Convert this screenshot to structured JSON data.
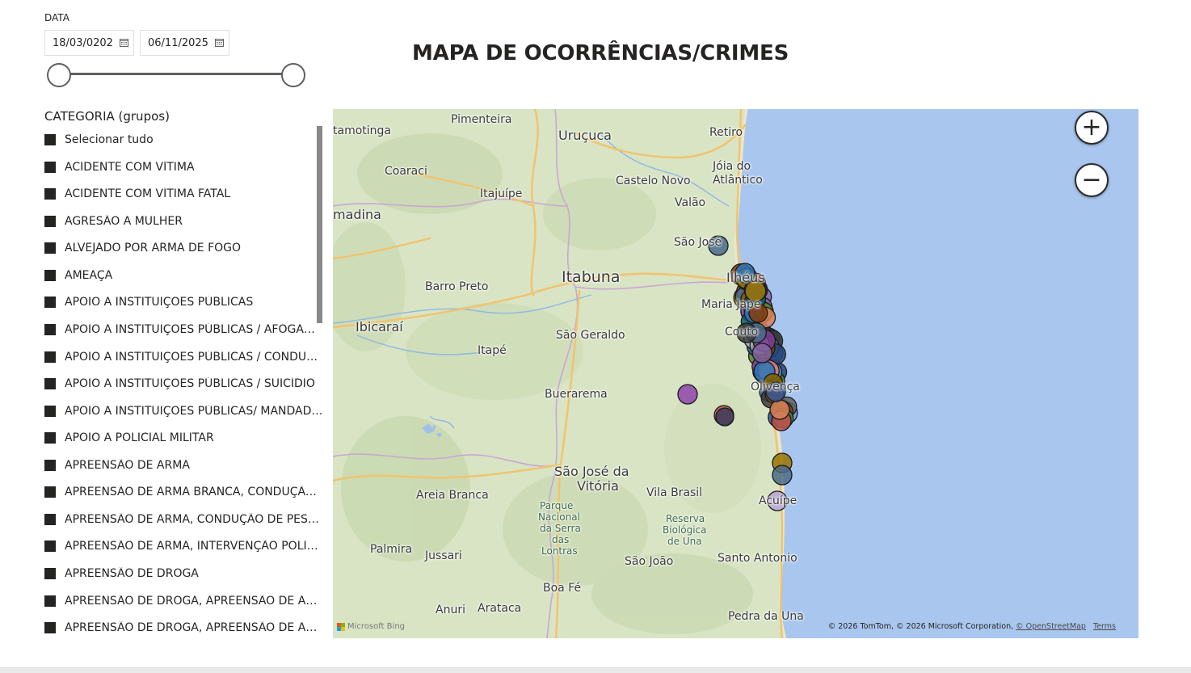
{
  "date_slicer": {
    "label": "DATA",
    "from": "18/03/0202",
    "to": "06/11/2025"
  },
  "title": "MAPA DE OCORRÊNCIAS/CRIMES",
  "category_slicer": {
    "header": "CATEGORIA (grupos)",
    "items": [
      "Selecionar tudo",
      "ACIDENTE COM VÍTIMA",
      "ACIDENTE COM VÍTIMA FATAL",
      "AGRESÃO A MULHER",
      "ALVEJADO POR ARMA DE FOGO",
      "AMEAÇA",
      "APOIO A INSTITUIÇÕES PÚBLICAS",
      "APOIO A INSTITUIÇÕES PÚBLICAS / AFOGAMENTO",
      "APOIO A INSTITUIÇÕES PÚBLICAS / CONDUÇÃO",
      "APOIO A INSTITUIÇÕES PÚBLICAS / SUICÍDIO",
      "APOIO A INSTITUIÇÕES PÚBLICAS/ MANDADO DE PRISÃO",
      "APOIO A POLICIAL MILITAR",
      "APREENSÃO DE ARMA",
      "APREENSÃO DE ARMA BRANCA, CONDUÇÃO DE PESSOA",
      "APREENSÃO DE ARMA, CONDUÇÃO DE PESSOA",
      "APREENSÃO DE ARMA, INTERVENÇÃO POLICIAL",
      "APREENSÃO DE DROGA",
      "APREENSÃO DE DROGA, APREENSÃO DE ARMA",
      "APREENSÃO DE DROGA, APREENSÃO DE ARMA, CONDUÇÃO"
    ]
  },
  "map": {
    "places": [
      {
        "name": "Pimenteira",
        "cls": ""
      },
      {
        "name": "Uruçuca",
        "cls": "med"
      },
      {
        "name": "Retiro",
        "cls": ""
      },
      {
        "name": "tamotinga",
        "cls": ""
      },
      {
        "name": "Coaraci",
        "cls": ""
      },
      {
        "name": "Castelo Novo",
        "cls": ""
      },
      {
        "name": "Jóia do",
        "cls": ""
      },
      {
        "name": "Atlântico",
        "cls": ""
      },
      {
        "name": "Itajuípe",
        "cls": ""
      },
      {
        "name": "Valão",
        "cls": ""
      },
      {
        "name": "madina",
        "cls": "med"
      },
      {
        "name": "São José",
        "cls": ""
      },
      {
        "name": "Itabuna",
        "cls": "big"
      },
      {
        "name": "Barro Preto",
        "cls": ""
      },
      {
        "name": "Ilhéus",
        "cls": "med"
      },
      {
        "name": "Maria Jape",
        "cls": ""
      },
      {
        "name": "Ibicaraí",
        "cls": "med"
      },
      {
        "name": "São Geraldo",
        "cls": ""
      },
      {
        "name": "Couto",
        "cls": ""
      },
      {
        "name": "Itapé",
        "cls": ""
      },
      {
        "name": "Olivença",
        "cls": ""
      },
      {
        "name": "Buerarema",
        "cls": ""
      },
      {
        "name": "São José da",
        "cls": "med"
      },
      {
        "name": "Vitória",
        "cls": "med"
      },
      {
        "name": "Areia Branca",
        "cls": ""
      },
      {
        "name": "Vila Brasil",
        "cls": ""
      },
      {
        "name": "Acuípe",
        "cls": ""
      },
      {
        "name": "Parque",
        "cls": "small"
      },
      {
        "name": "Nacional",
        "cls": "small"
      },
      {
        "name": "da Serra",
        "cls": "small"
      },
      {
        "name": "das",
        "cls": "small"
      },
      {
        "name": "Lontras",
        "cls": "small"
      },
      {
        "name": "Reserva",
        "cls": "small"
      },
      {
        "name": "Biológica",
        "cls": "small"
      },
      {
        "name": "de Una",
        "cls": "small"
      },
      {
        "name": "Palmira",
        "cls": ""
      },
      {
        "name": "Jussari",
        "cls": ""
      },
      {
        "name": "São João",
        "cls": ""
      },
      {
        "name": "Santo Antonio",
        "cls": ""
      },
      {
        "name": "Boa Fé",
        "cls": ""
      },
      {
        "name": "Anuri",
        "cls": ""
      },
      {
        "name": "Arataca",
        "cls": ""
      },
      {
        "name": "Pedra da Una",
        "cls": ""
      }
    ],
    "zoom_in": "+",
    "zoom_out": "−",
    "provider": "Microsoft Bing",
    "attribution": "© 2026 TomTom, © 2026 Microsoft Corporation,",
    "osm_link": "© OpenStreetMap",
    "terms_link": "Terms",
    "colors": {
      "land": "#d8e4c4",
      "ocean": "#a9c6ee",
      "road": "#f2c36b",
      "border": "#c9a7d4",
      "river": "#8fb7e3"
    }
  }
}
